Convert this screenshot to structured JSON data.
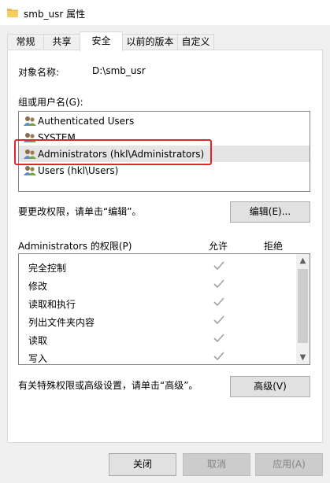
{
  "window": {
    "title": "smb_usr 属性"
  },
  "tabs": [
    {
      "label": "常规"
    },
    {
      "label": "共享"
    },
    {
      "label": "安全"
    },
    {
      "label": "以前的版本"
    },
    {
      "label": "自定义"
    }
  ],
  "active_tab": "安全",
  "object": {
    "label": "对象名称:",
    "value": "D:\\smb_usr"
  },
  "groups": {
    "label": "组或用户名(G):",
    "items": [
      {
        "label": "Authenticated Users"
      },
      {
        "label": "SYSTEM"
      },
      {
        "label": "Administrators (hkl\\Administrators)"
      },
      {
        "label": "Users (hkl\\Users)"
      }
    ],
    "selected": "Administrators (hkl\\Administrators)"
  },
  "change_perm": {
    "text": "要更改权限，请单击“编辑”。",
    "edit_button": "编辑(E)..."
  },
  "permissions": {
    "title": "Administrators 的权限(P)",
    "allow_header": "允许",
    "deny_header": "拒绝",
    "rows": [
      {
        "name": "完全控制",
        "allow": true
      },
      {
        "name": "修改",
        "allow": true
      },
      {
        "name": "读取和执行",
        "allow": true
      },
      {
        "name": "列出文件夹内容",
        "allow": true
      },
      {
        "name": "读取",
        "allow": true
      },
      {
        "name": "写入",
        "allow": true
      }
    ]
  },
  "advanced": {
    "text": "有关特殊权限或高级设置，请单击“高级”。",
    "button": "高级(V)"
  },
  "footer": {
    "close": "关闭",
    "cancel": "取消",
    "apply": "应用(A)"
  },
  "colors": {
    "highlight": "#e0262b",
    "check": "#a0a0a0"
  }
}
